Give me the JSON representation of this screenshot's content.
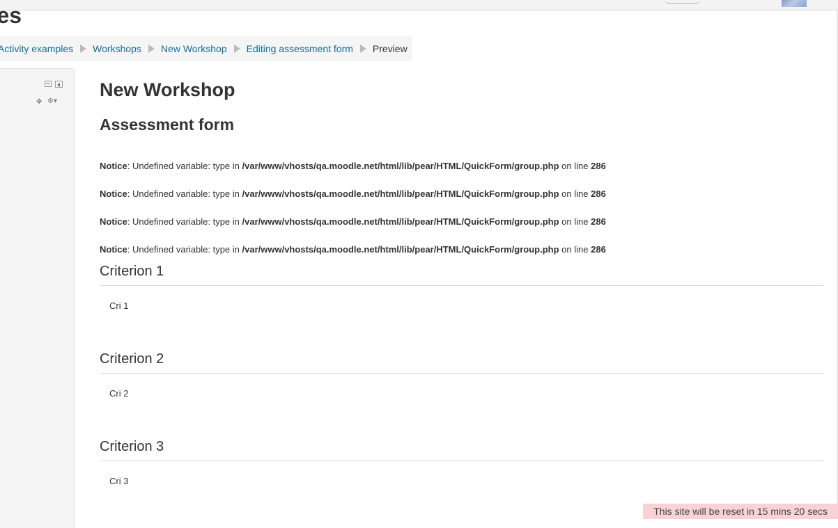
{
  "header": {
    "site_title": "ples"
  },
  "breadcrumb": {
    "items": [
      {
        "label": "Activity examples"
      },
      {
        "label": "Workshops"
      },
      {
        "label": "New Workshop"
      },
      {
        "label": "Editing assessment form"
      },
      {
        "label": "Preview"
      }
    ]
  },
  "main": {
    "page_heading": "New Workshop",
    "form_heading": "Assessment form",
    "notices": [
      {
        "label": "Notice",
        "message": ": Undefined variable: type in ",
        "path": "/var/www/vhosts/qa.moodle.net/html/lib/pear/HTML/QuickForm/group.php",
        "on_line": " on line ",
        "line": "286"
      },
      {
        "label": "Notice",
        "message": ": Undefined variable: type in ",
        "path": "/var/www/vhosts/qa.moodle.net/html/lib/pear/HTML/QuickForm/group.php",
        "on_line": " on line ",
        "line": "286"
      },
      {
        "label": "Notice",
        "message": ": Undefined variable: type in ",
        "path": "/var/www/vhosts/qa.moodle.net/html/lib/pear/HTML/QuickForm/group.php",
        "on_line": " on line ",
        "line": "286"
      },
      {
        "label": "Notice",
        "message": ": Undefined variable: type in ",
        "path": "/var/www/vhosts/qa.moodle.net/html/lib/pear/HTML/QuickForm/group.php",
        "on_line": " on line ",
        "line": "286"
      }
    ],
    "criteria": [
      {
        "title": "Criterion 1",
        "description": "Cri 1"
      },
      {
        "title": "Criterion 2",
        "description": "Cri 2"
      },
      {
        "title": "Criterion 3",
        "description": "Cri 3"
      }
    ]
  },
  "block_controls": {
    "move_icon": "✥",
    "gear_icon": "⚙▾"
  },
  "footer": {
    "reset_notice": "This site will be reset in 15 mins 20 secs"
  },
  "colors": {
    "link": "#0f6ea0",
    "reset_banner_bg": "#f8d2d5"
  }
}
